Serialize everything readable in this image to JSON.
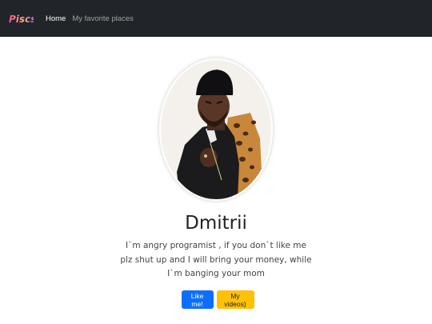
{
  "navbar": {
    "brand": "Piscs",
    "links": [
      {
        "label": "Home"
      },
      {
        "label": "My favorite places"
      }
    ]
  },
  "profile": {
    "name": "Dmitrii",
    "bio": "I`m angry programist , if you don`t like me plz shut up and I will bring your money, while I`m banging your mom"
  },
  "buttons": {
    "like_label": "Like me!",
    "videos_label": "My videos)"
  },
  "colors": {
    "navbar_bg": "#212529",
    "primary": "#0d6efd",
    "warning": "#ffc107"
  },
  "icons": {
    "brand": "piscs-logo-icon",
    "avatar": "avatar-photo"
  }
}
